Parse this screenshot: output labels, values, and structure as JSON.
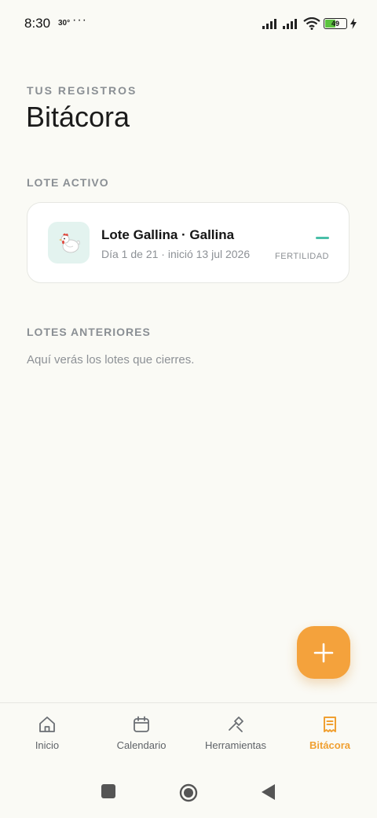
{
  "status_bar": {
    "time": "8:30",
    "temp": "30°",
    "more": "···",
    "battery": "49"
  },
  "header": {
    "eyebrow": "TUS REGISTROS",
    "title": "Bitácora"
  },
  "active_section": {
    "label": "LOTE ACTIVO",
    "card": {
      "title": "Lote Gallina · Gallina",
      "subtitle": "Día 1 de 21 · inició 13 jul 2026",
      "tag": "FERTILIDAD",
      "icon": "hen-icon"
    }
  },
  "past_section": {
    "label": "LOTES ANTERIORES",
    "empty_text": "Aquí verás los lotes que cierres."
  },
  "fab": {
    "icon": "plus-icon"
  },
  "bottom_nav": {
    "items": [
      {
        "label": "Inicio",
        "icon": "home-icon",
        "active": false
      },
      {
        "label": "Calendario",
        "icon": "calendar-icon",
        "active": false
      },
      {
        "label": "Herramientas",
        "icon": "tools-icon",
        "active": false
      },
      {
        "label": "Bitácora",
        "icon": "receipt-icon",
        "active": true
      }
    ]
  },
  "colors": {
    "accent": "#f4a23c",
    "teal": "#49bfa8",
    "background": "#fafaf5"
  }
}
